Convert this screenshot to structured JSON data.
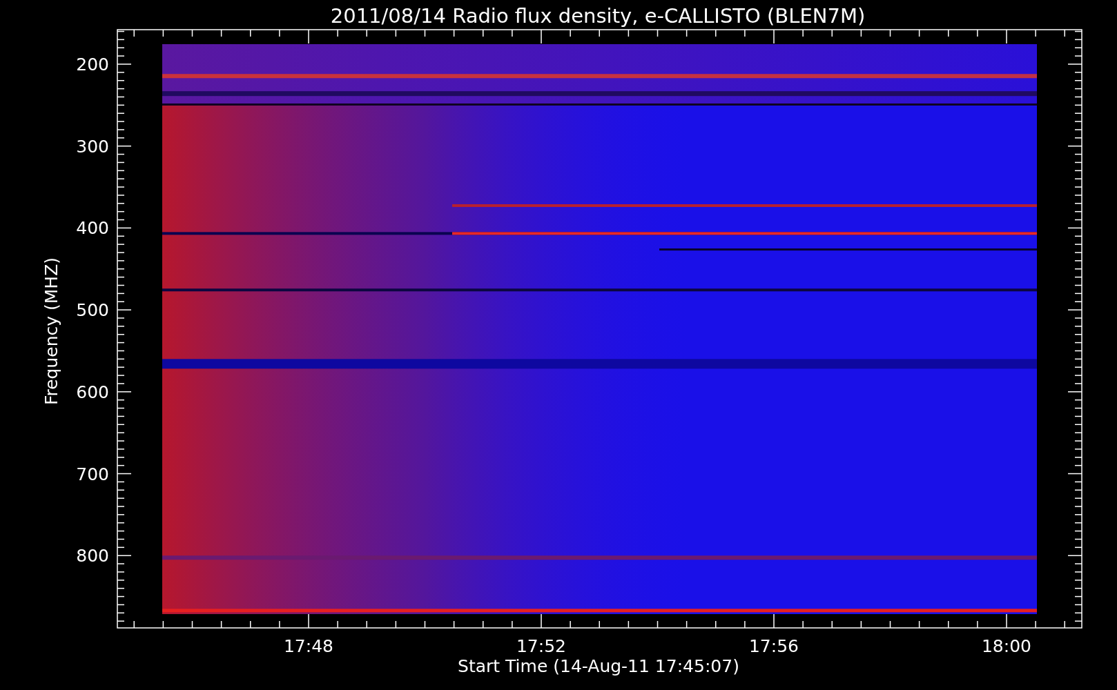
{
  "title": "2011/08/14  Radio flux density, e-CALLISTO (BLEN7M)",
  "y_axis": {
    "label": "Frequency (MHZ)",
    "ticks": [
      "200",
      "300",
      "400",
      "500",
      "600",
      "700",
      "800"
    ]
  },
  "x_axis": {
    "label": "Start Time (14-Aug-11 17:45:07)",
    "ticks": [
      "17:48",
      "17:52",
      "17:56",
      "18:00"
    ]
  }
}
